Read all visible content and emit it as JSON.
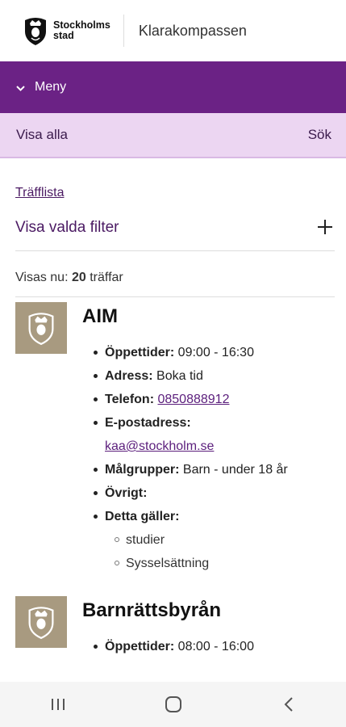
{
  "header": {
    "logo_line1": "Stockholms",
    "logo_line2": "stad",
    "app_title": "Klarakompassen"
  },
  "menu": {
    "label": "Meny",
    "icon": "chevron-down-icon"
  },
  "tabs": {
    "left": "Visa alla",
    "right": "Sök"
  },
  "breadcrumb": "Träfflista",
  "filter": {
    "label": "Visa valda filter",
    "icon": "plus-icon"
  },
  "count": {
    "prefix": "Visas nu:",
    "number": "20",
    "suffix": "träffar"
  },
  "results": [
    {
      "title": "AIM",
      "oppettider_label": "Öppettider:",
      "oppettider": "09:00 - 16:30",
      "adress_label": "Adress:",
      "adress": "Boka tid",
      "telefon_label": "Telefon:",
      "telefon": "0850888912",
      "epost_label": "E-postadress:",
      "epost": "kaa@stockholm.se",
      "malgrupper_label": "Målgrupper:",
      "malgrupper": "Barn - under 18 år",
      "ovrigt_label": "Övrigt:",
      "galler_label": "Detta gäller:",
      "galler": [
        "studier",
        "Sysselsättning"
      ]
    },
    {
      "title": "Barnrättsbyrån",
      "oppettider_label": "Öppettider:",
      "oppettider": "08:00 - 16:00"
    }
  ],
  "colors": {
    "menu_bg": "#6b2285",
    "tabs_bg": "#ecd6f2",
    "link": "#5b1e7c",
    "thumb_bg": "#a89a80"
  }
}
